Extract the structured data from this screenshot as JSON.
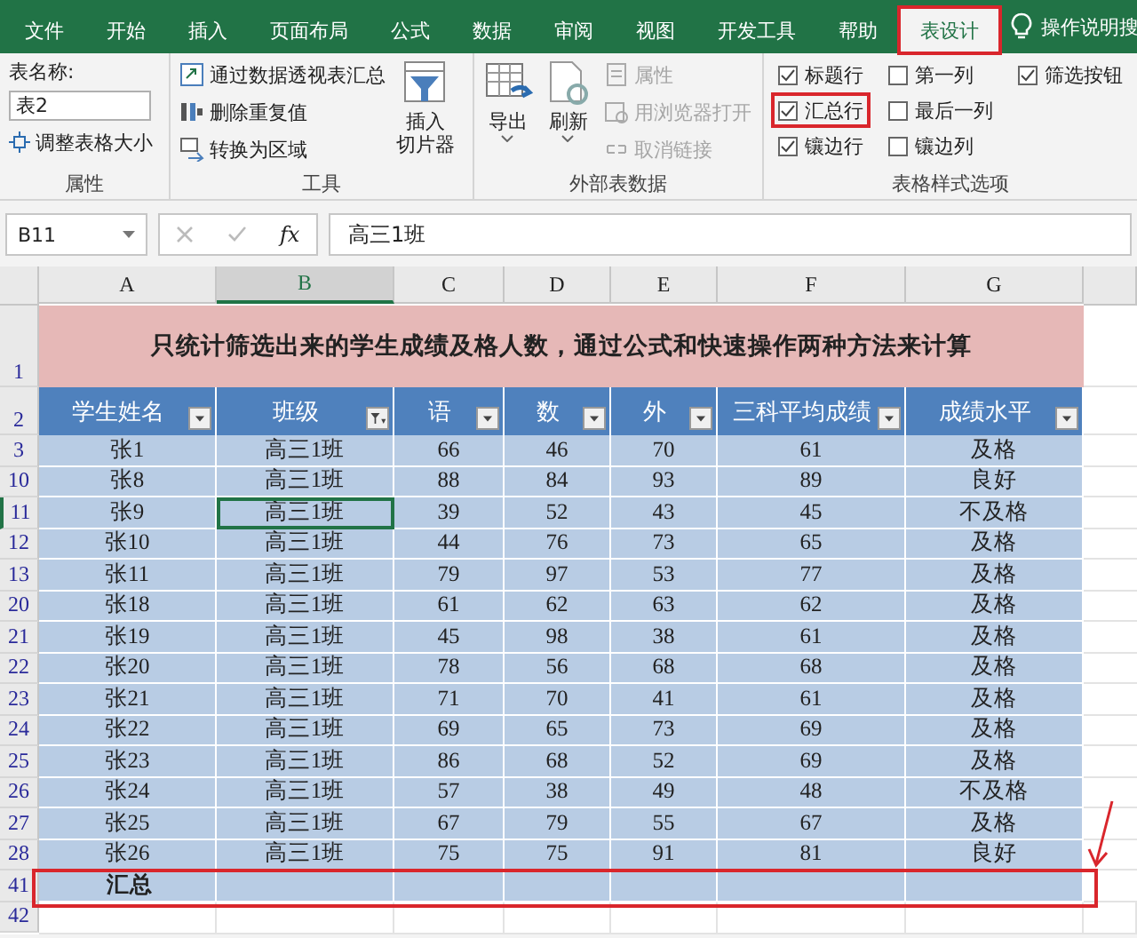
{
  "ribbon_tabs": [
    {
      "label": "文件",
      "selected": false,
      "highlighted": false
    },
    {
      "label": "开始",
      "selected": false,
      "highlighted": false
    },
    {
      "label": "插入",
      "selected": false,
      "highlighted": false
    },
    {
      "label": "页面布局",
      "selected": false,
      "highlighted": false
    },
    {
      "label": "公式",
      "selected": false,
      "highlighted": false
    },
    {
      "label": "数据",
      "selected": false,
      "highlighted": false
    },
    {
      "label": "审阅",
      "selected": false,
      "highlighted": false
    },
    {
      "label": "视图",
      "selected": false,
      "highlighted": false
    },
    {
      "label": "开发工具",
      "selected": false,
      "highlighted": false
    },
    {
      "label": "帮助",
      "selected": false,
      "highlighted": false
    },
    {
      "label": "表设计",
      "selected": true,
      "highlighted": true
    }
  ],
  "tell_me": {
    "placeholder": "操作说明搜"
  },
  "properties_group": {
    "name_label": "表名称:",
    "table_name": "表2",
    "resize_button": "调整表格大小",
    "title": "属性"
  },
  "tools_group": {
    "buttons": [
      {
        "label": "通过数据透视表汇总",
        "kind": "pivot"
      },
      {
        "label": "删除重复值",
        "kind": "dedupe"
      },
      {
        "label": "转换为区域",
        "kind": "convert"
      }
    ],
    "slicer_button": [
      "插入",
      "切片器"
    ],
    "title": "工具"
  },
  "external_group": {
    "large_buttons": [
      {
        "label": "导出",
        "kind": "export"
      },
      {
        "label": "刷新",
        "kind": "refresh"
      }
    ],
    "small_buttons": [
      {
        "label": "属性",
        "disabled": true,
        "kind": "props"
      },
      {
        "label": "用浏览器打开",
        "disabled": true,
        "kind": "browser"
      },
      {
        "label": "取消链接",
        "disabled": true,
        "kind": "unlink"
      }
    ],
    "title": "外部表数据"
  },
  "style_options": {
    "checkboxes": [
      {
        "label": "标题行",
        "checked": true,
        "highlighted": false
      },
      {
        "label": "汇总行",
        "checked": true,
        "highlighted": true
      },
      {
        "label": "镶边行",
        "checked": true,
        "highlighted": false
      },
      {
        "label": "第一列",
        "checked": false,
        "highlighted": false
      },
      {
        "label": "最后一列",
        "checked": false,
        "highlighted": false
      },
      {
        "label": "镶边列",
        "checked": false,
        "highlighted": false
      },
      {
        "label": "筛选按钮",
        "checked": true,
        "highlighted": false
      }
    ],
    "title": "表格样式选项"
  },
  "formula_bar": {
    "name_box": "B11",
    "function_label": "fx",
    "formula": "高三1班"
  },
  "columns": [
    {
      "label": "A",
      "selected": false
    },
    {
      "label": "B",
      "selected": true
    },
    {
      "label": "C",
      "selected": false
    },
    {
      "label": "D",
      "selected": false
    },
    {
      "label": "E",
      "selected": false
    },
    {
      "label": "F",
      "selected": false
    },
    {
      "label": "G",
      "selected": false
    }
  ],
  "title_row": {
    "row": "1",
    "text": "只统计筛选出来的学生成绩及格人数，通过公式和快速操作两种方法来计算"
  },
  "header_row": {
    "row": "2",
    "cells": [
      {
        "label": "学生姓名",
        "filtered": false
      },
      {
        "label": "班级",
        "filtered": true
      },
      {
        "label": "语",
        "filtered": false
      },
      {
        "label": "数",
        "filtered": false
      },
      {
        "label": "外",
        "filtered": false
      },
      {
        "label": "三科平均成绩",
        "filtered": false
      },
      {
        "label": "成绩水平",
        "filtered": false
      }
    ]
  },
  "rows": [
    {
      "row": "3",
      "selected": false,
      "cells": [
        "张1",
        "高三1班",
        "66",
        "46",
        "70",
        "61",
        "及格"
      ]
    },
    {
      "row": "10",
      "selected": false,
      "cells": [
        "张8",
        "高三1班",
        "88",
        "84",
        "93",
        "89",
        "良好"
      ]
    },
    {
      "row": "11",
      "selected": true,
      "cells": [
        "张9",
        "高三1班",
        "39",
        "52",
        "43",
        "45",
        "不及格"
      ]
    },
    {
      "row": "12",
      "selected": false,
      "cells": [
        "张10",
        "高三1班",
        "44",
        "76",
        "73",
        "65",
        "及格"
      ]
    },
    {
      "row": "13",
      "selected": false,
      "cells": [
        "张11",
        "高三1班",
        "79",
        "97",
        "53",
        "77",
        "及格"
      ]
    },
    {
      "row": "20",
      "selected": false,
      "cells": [
        "张18",
        "高三1班",
        "61",
        "62",
        "63",
        "62",
        "及格"
      ]
    },
    {
      "row": "21",
      "selected": false,
      "cells": [
        "张19",
        "高三1班",
        "45",
        "98",
        "38",
        "61",
        "及格"
      ]
    },
    {
      "row": "22",
      "selected": false,
      "cells": [
        "张20",
        "高三1班",
        "78",
        "56",
        "68",
        "68",
        "及格"
      ]
    },
    {
      "row": "23",
      "selected": false,
      "cells": [
        "张21",
        "高三1班",
        "71",
        "70",
        "41",
        "61",
        "及格"
      ]
    },
    {
      "row": "24",
      "selected": false,
      "cells": [
        "张22",
        "高三1班",
        "69",
        "65",
        "73",
        "69",
        "及格"
      ]
    },
    {
      "row": "25",
      "selected": false,
      "cells": [
        "张23",
        "高三1班",
        "86",
        "68",
        "52",
        "69",
        "及格"
      ]
    },
    {
      "row": "26",
      "selected": false,
      "cells": [
        "张24",
        "高三1班",
        "57",
        "38",
        "49",
        "48",
        "不及格"
      ]
    },
    {
      "row": "27",
      "selected": false,
      "cells": [
        "张25",
        "高三1班",
        "67",
        "79",
        "55",
        "67",
        "及格"
      ]
    },
    {
      "row": "28",
      "selected": false,
      "cells": [
        "张26",
        "高三1班",
        "75",
        "75",
        "91",
        "81",
        "良好"
      ]
    }
  ],
  "total_row": {
    "row": "41",
    "label": "汇总",
    "highlighted": true,
    "arrow": true
  },
  "empty_rows": [
    "42"
  ]
}
